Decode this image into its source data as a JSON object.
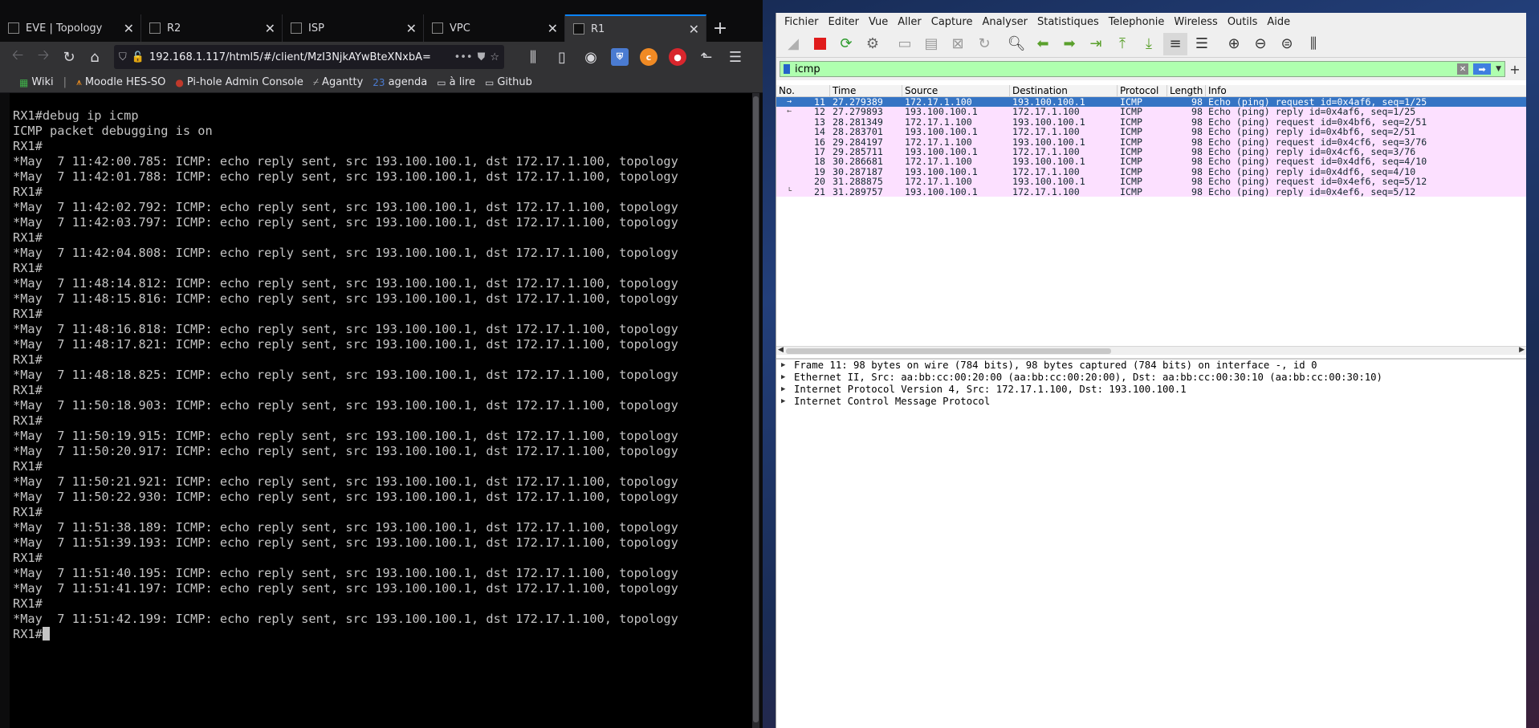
{
  "firefox": {
    "tabs": [
      {
        "title": "EVE | Topology",
        "active": false
      },
      {
        "title": "R2",
        "active": false
      },
      {
        "title": "ISP",
        "active": false
      },
      {
        "title": "VPC",
        "active": false
      },
      {
        "title": "R1",
        "active": true
      }
    ],
    "new_tab_label": "+",
    "url": "192.168.1.117/html5/#/client/MzI3NjkAYwBteXNxbA=",
    "bookmarks": [
      {
        "label": "Wiki",
        "icon": "wiki-icon"
      },
      {
        "label": "Moodle HES-SO",
        "icon": "moodle-icon"
      },
      {
        "label": "Pi-hole Admin Console",
        "icon": "pihole-icon"
      },
      {
        "label": "Agantty",
        "icon": "agantty-icon"
      },
      {
        "label": "agenda",
        "icon": "calendar-icon"
      },
      {
        "label": "à lire",
        "icon": "folder-icon"
      },
      {
        "label": "Github",
        "icon": "folder-icon"
      }
    ],
    "terminal": {
      "lines": [
        "RX1#debug ip icmp",
        "ICMP packet debugging is on",
        "RX1#",
        "*May  7 11:42:00.785: ICMP: echo reply sent, src 193.100.100.1, dst 172.17.1.100, topology",
        "*May  7 11:42:01.788: ICMP: echo reply sent, src 193.100.100.1, dst 172.17.1.100, topology",
        "RX1#",
        "*May  7 11:42:02.792: ICMP: echo reply sent, src 193.100.100.1, dst 172.17.1.100, topology",
        "*May  7 11:42:03.797: ICMP: echo reply sent, src 193.100.100.1, dst 172.17.1.100, topology",
        "RX1#",
        "*May  7 11:42:04.808: ICMP: echo reply sent, src 193.100.100.1, dst 172.17.1.100, topology",
        "RX1#",
        "*May  7 11:48:14.812: ICMP: echo reply sent, src 193.100.100.1, dst 172.17.1.100, topology",
        "*May  7 11:48:15.816: ICMP: echo reply sent, src 193.100.100.1, dst 172.17.1.100, topology",
        "RX1#",
        "*May  7 11:48:16.818: ICMP: echo reply sent, src 193.100.100.1, dst 172.17.1.100, topology",
        "*May  7 11:48:17.821: ICMP: echo reply sent, src 193.100.100.1, dst 172.17.1.100, topology",
        "RX1#",
        "*May  7 11:48:18.825: ICMP: echo reply sent, src 193.100.100.1, dst 172.17.1.100, topology",
        "RX1#",
        "*May  7 11:50:18.903: ICMP: echo reply sent, src 193.100.100.1, dst 172.17.1.100, topology",
        "RX1#",
        "*May  7 11:50:19.915: ICMP: echo reply sent, src 193.100.100.1, dst 172.17.1.100, topology",
        "*May  7 11:50:20.917: ICMP: echo reply sent, src 193.100.100.1, dst 172.17.1.100, topology",
        "RX1#",
        "*May  7 11:50:21.921: ICMP: echo reply sent, src 193.100.100.1, dst 172.17.1.100, topology",
        "*May  7 11:50:22.930: ICMP: echo reply sent, src 193.100.100.1, dst 172.17.1.100, topology",
        "RX1#",
        "*May  7 11:51:38.189: ICMP: echo reply sent, src 193.100.100.1, dst 172.17.1.100, topology",
        "*May  7 11:51:39.193: ICMP: echo reply sent, src 193.100.100.1, dst 172.17.1.100, topology",
        "RX1#",
        "*May  7 11:51:40.195: ICMP: echo reply sent, src 193.100.100.1, dst 172.17.1.100, topology",
        "*May  7 11:51:41.197: ICMP: echo reply sent, src 193.100.100.1, dst 172.17.1.100, topology",
        "RX1#",
        "*May  7 11:51:42.199: ICMP: echo reply sent, src 193.100.100.1, dst 172.17.1.100, topology"
      ],
      "prompt": "RX1#"
    }
  },
  "wireshark": {
    "menu": [
      "Fichier",
      "Editer",
      "Vue",
      "Aller",
      "Capture",
      "Analyser",
      "Statistiques",
      "Telephonie",
      "Wireless",
      "Outils",
      "Aide"
    ],
    "filter": {
      "value": "icmp",
      "plus_label": "+"
    },
    "columns": {
      "no": "No.",
      "time": "Time",
      "source": "Source",
      "destination": "Destination",
      "protocol": "Protocol",
      "length": "Length",
      "info": "Info"
    },
    "packets": [
      {
        "no": "11",
        "time": "27.279389",
        "src": "172.17.1.100",
        "dst": "193.100.100.1",
        "proto": "ICMP",
        "len": "98",
        "info": "Echo (ping) request  id=0x4af6, seq=1/25",
        "selected": true,
        "mark": "→"
      },
      {
        "no": "12",
        "time": "27.279893",
        "src": "193.100.100.1",
        "dst": "172.17.1.100",
        "proto": "ICMP",
        "len": "98",
        "info": "Echo (ping) reply    id=0x4af6, seq=1/25",
        "mark": "←"
      },
      {
        "no": "13",
        "time": "28.281349",
        "src": "172.17.1.100",
        "dst": "193.100.100.1",
        "proto": "ICMP",
        "len": "98",
        "info": "Echo (ping) request  id=0x4bf6, seq=2/51",
        "mark": ""
      },
      {
        "no": "14",
        "time": "28.283701",
        "src": "193.100.100.1",
        "dst": "172.17.1.100",
        "proto": "ICMP",
        "len": "98",
        "info": "Echo (ping) reply    id=0x4bf6, seq=2/51",
        "mark": ""
      },
      {
        "no": "16",
        "time": "29.284197",
        "src": "172.17.1.100",
        "dst": "193.100.100.1",
        "proto": "ICMP",
        "len": "98",
        "info": "Echo (ping) request  id=0x4cf6, seq=3/76",
        "mark": ""
      },
      {
        "no": "17",
        "time": "29.285711",
        "src": "193.100.100.1",
        "dst": "172.17.1.100",
        "proto": "ICMP",
        "len": "98",
        "info": "Echo (ping) reply    id=0x4cf6, seq=3/76",
        "mark": ""
      },
      {
        "no": "18",
        "time": "30.286681",
        "src": "172.17.1.100",
        "dst": "193.100.100.1",
        "proto": "ICMP",
        "len": "98",
        "info": "Echo (ping) request  id=0x4df6, seq=4/10",
        "mark": ""
      },
      {
        "no": "19",
        "time": "30.287187",
        "src": "193.100.100.1",
        "dst": "172.17.1.100",
        "proto": "ICMP",
        "len": "98",
        "info": "Echo (ping) reply    id=0x4df6, seq=4/10",
        "mark": ""
      },
      {
        "no": "20",
        "time": "31.288875",
        "src": "172.17.1.100",
        "dst": "193.100.100.1",
        "proto": "ICMP",
        "len": "98",
        "info": "Echo (ping) request  id=0x4ef6, seq=5/12",
        "mark": ""
      },
      {
        "no": "21",
        "time": "31.289757",
        "src": "193.100.100.1",
        "dst": "172.17.1.100",
        "proto": "ICMP",
        "len": "98",
        "info": "Echo (ping) reply    id=0x4ef6, seq=5/12",
        "mark": "└"
      }
    ],
    "details": [
      "Frame 11: 98 bytes on wire (784 bits), 98 bytes captured (784 bits) on interface -, id 0",
      "Ethernet II, Src: aa:bb:cc:00:20:00 (aa:bb:cc:00:20:00), Dst: aa:bb:cc:00:30:10 (aa:bb:cc:00:30:10)",
      "Internet Protocol Version 4, Src: 172.17.1.100, Dst: 193.100.100.1",
      "Internet Control Message Protocol"
    ]
  }
}
